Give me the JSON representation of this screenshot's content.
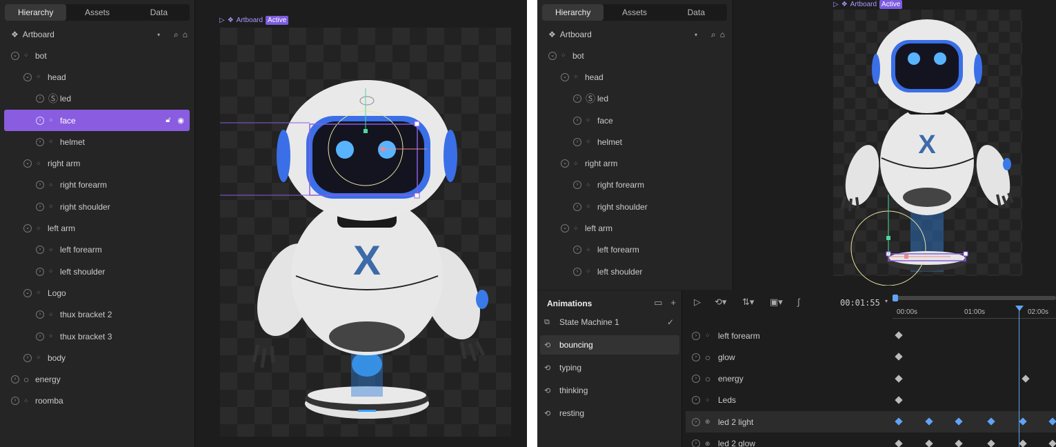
{
  "left": {
    "tabs": [
      "Hierarchy",
      "Assets",
      "Data"
    ],
    "artboard_label": "Artboard",
    "tree": [
      {
        "label": "bot",
        "depth": 0,
        "expanded": true,
        "icon": "group-icon"
      },
      {
        "label": "head",
        "depth": 1,
        "expanded": true,
        "icon": "group-icon"
      },
      {
        "label": "led",
        "depth": 2,
        "expanded": false,
        "icon": "solo-icon"
      },
      {
        "label": "face",
        "depth": 2,
        "expanded": false,
        "icon": "group-icon",
        "selected": true
      },
      {
        "label": "helmet",
        "depth": 2,
        "expanded": false,
        "icon": "group-icon"
      },
      {
        "label": "right arm",
        "depth": 1,
        "expanded": true,
        "icon": "group-icon"
      },
      {
        "label": "right forearm",
        "depth": 2,
        "expanded": false,
        "icon": "group-icon"
      },
      {
        "label": "right shoulder",
        "depth": 2,
        "expanded": false,
        "icon": "group-icon"
      },
      {
        "label": "left arm",
        "depth": 1,
        "expanded": true,
        "icon": "group-icon"
      },
      {
        "label": "left forearm",
        "depth": 2,
        "expanded": false,
        "icon": "group-icon"
      },
      {
        "label": "left shoulder",
        "depth": 2,
        "expanded": false,
        "icon": "group-icon"
      },
      {
        "label": "Logo",
        "depth": 1,
        "expanded": true,
        "icon": "group-icon"
      },
      {
        "label": "thux bracket 2",
        "depth": 2,
        "expanded": false,
        "icon": "group-icon"
      },
      {
        "label": "thux bracket 3",
        "depth": 2,
        "expanded": false,
        "icon": "group-icon"
      },
      {
        "label": "body",
        "depth": 1,
        "expanded": false,
        "icon": "group-icon"
      },
      {
        "label": "energy",
        "depth": 0,
        "expanded": false,
        "icon": "ellipse-icon"
      },
      {
        "label": "roomba",
        "depth": 0,
        "expanded": false,
        "icon": "group-icon"
      }
    ],
    "canvas_artboard_label": "Artboard",
    "canvas_badge": "Active",
    "logo_letter": "X"
  },
  "right": {
    "tabs": [
      "Hierarchy",
      "Assets",
      "Data"
    ],
    "artboard_label": "Artboard",
    "tree": [
      {
        "label": "bot",
        "depth": 0,
        "expanded": true,
        "icon": "group-icon"
      },
      {
        "label": "head",
        "depth": 1,
        "expanded": true,
        "icon": "group-icon"
      },
      {
        "label": "led",
        "depth": 2,
        "expanded": false,
        "icon": "solo-icon"
      },
      {
        "label": "face",
        "depth": 2,
        "expanded": false,
        "icon": "group-icon"
      },
      {
        "label": "helmet",
        "depth": 2,
        "expanded": false,
        "icon": "group-icon"
      },
      {
        "label": "right arm",
        "depth": 1,
        "expanded": true,
        "icon": "group-icon"
      },
      {
        "label": "right forearm",
        "depth": 2,
        "expanded": false,
        "icon": "group-icon"
      },
      {
        "label": "right shoulder",
        "depth": 2,
        "expanded": false,
        "icon": "group-icon"
      },
      {
        "label": "left arm",
        "depth": 1,
        "expanded": true,
        "icon": "group-icon"
      },
      {
        "label": "left forearm",
        "depth": 2,
        "expanded": false,
        "icon": "group-icon"
      },
      {
        "label": "left shoulder",
        "depth": 2,
        "expanded": false,
        "icon": "group-icon"
      }
    ],
    "canvas_artboard_label": "Artboard",
    "canvas_badge": "Active",
    "logo_letter": "X",
    "animations": {
      "title": "Animations",
      "items": [
        {
          "label": "State Machine 1",
          "icon": "state-machine-icon",
          "check": "✓"
        },
        {
          "label": "bouncing",
          "icon": "loop-icon",
          "selected": true
        },
        {
          "label": "typing",
          "icon": "loop-icon"
        },
        {
          "label": "thinking",
          "icon": "loop-icon"
        },
        {
          "label": "resting",
          "icon": "loop-icon"
        }
      ]
    },
    "timeline": {
      "time": "00:01:55",
      "ruler": [
        "00:00s",
        "01:00s",
        "02:00s"
      ],
      "rows": [
        {
          "label": "left forearm",
          "icon": "group-icon"
        },
        {
          "label": "glow",
          "icon": "ellipse-icon"
        },
        {
          "label": "energy",
          "icon": "ellipse-icon"
        },
        {
          "label": "Leds",
          "icon": "group-icon"
        },
        {
          "label": "led 2 light",
          "icon": "shapes-icon",
          "selected": true
        },
        {
          "label": "led 2 glow",
          "icon": "shapes-icon"
        }
      ]
    }
  },
  "colors": {
    "accent": "#8a5ce0",
    "led": "#3aa0ff",
    "bone": "#e6e6e6",
    "key": "#5fa4f5"
  }
}
